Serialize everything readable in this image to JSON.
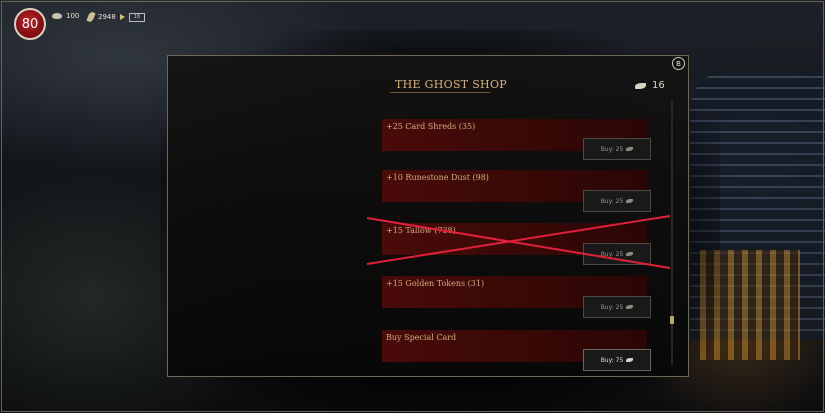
{
  "hud": {
    "level": "80",
    "stones": "100",
    "leaves": "2948",
    "bar_label": "18"
  },
  "shop": {
    "title": "THE GHOST SHOP",
    "currency": "16",
    "close_key": "B",
    "items": [
      {
        "label": "+25 Card Shreds (35)",
        "button": "Buy: 25"
      },
      {
        "label": "+10 Runestone Dust (98)",
        "button": "Buy: 25"
      },
      {
        "label": "+15 Tallow (738)",
        "button": "Buy: 25"
      },
      {
        "label": "+15 Golden Tokens (31)",
        "button": "Buy: 25"
      },
      {
        "label": "Buy Special Card",
        "button": "Buy: 75"
      }
    ]
  },
  "colors": {
    "accent_gold": "#d7b57a",
    "item_red": "#4a0b09",
    "cross_red": "#e0203a"
  }
}
